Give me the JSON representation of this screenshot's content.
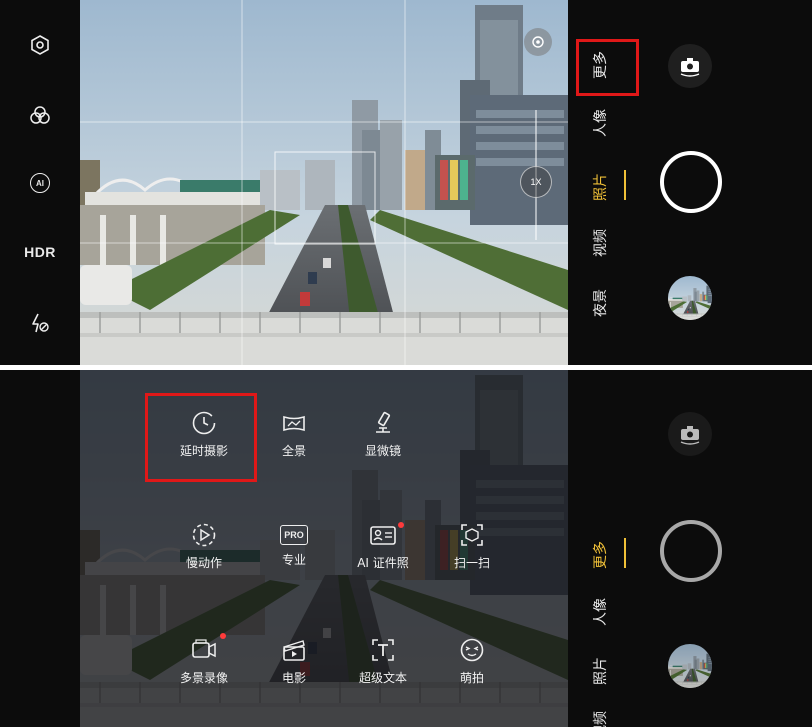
{
  "top": {
    "left_bar": {
      "items": [
        {
          "name": "settings",
          "icon": "hexagon-settings-icon"
        },
        {
          "name": "filter",
          "icon": "filter-circles-icon"
        },
        {
          "name": "ai",
          "icon": "ai-icon",
          "label": "AI"
        },
        {
          "name": "hdr",
          "label": "HDR"
        },
        {
          "name": "flash-off",
          "icon": "flash-off-icon"
        }
      ]
    },
    "zoom_label": "1X",
    "modes": [
      "更多",
      "人像",
      "照片",
      "视频",
      "夜景"
    ],
    "active_mode": "照片",
    "highlight_color": "#e01818",
    "accent_color": "#f0c037"
  },
  "bottom": {
    "more_modes": [
      {
        "label": "延时摄影",
        "icon": "clock-icon"
      },
      {
        "label": "全景",
        "icon": "panorama-icon"
      },
      {
        "label": "显微镜",
        "icon": "microscope-icon"
      },
      {
        "label": "慢动作",
        "icon": "slow-motion-icon"
      },
      {
        "label": "专业",
        "icon": "pro-icon",
        "badge": "PRO"
      },
      {
        "label": "AI 证件照",
        "icon": "id-photo-icon"
      },
      {
        "label": "扫一扫",
        "icon": "scan-icon"
      },
      {
        "label": "多景录像",
        "icon": "multi-view-video-icon"
      },
      {
        "label": "电影",
        "icon": "movie-clapper-icon"
      },
      {
        "label": "超级文本",
        "icon": "super-text-icon"
      },
      {
        "label": "萌拍",
        "icon": "cute-face-icon"
      }
    ],
    "modes": [
      "更多",
      "人像",
      "照片",
      "视频"
    ],
    "active_mode": "更多"
  }
}
